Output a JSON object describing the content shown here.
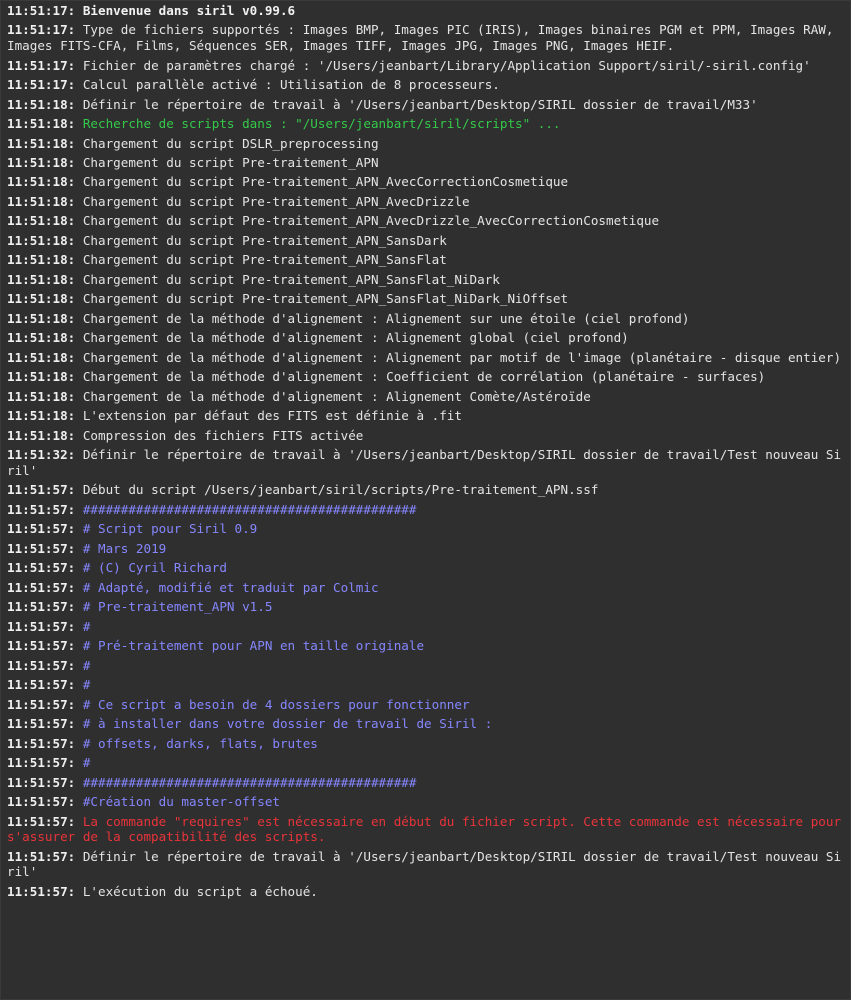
{
  "colors": {
    "background": "#2f2f2f",
    "text": "#e4e4e4",
    "green": "#35c94a",
    "blue": "#8686ff",
    "red": "#e8343a"
  },
  "log": [
    {
      "time": "11:51:17:",
      "text": "Bienvenue dans siril v0.99.6",
      "style": "bold"
    },
    {
      "time": "11:51:17:",
      "text": "Type de fichiers supportés : Images BMP, Images PIC (IRIS), Images binaires PGM et PPM, Images RAW, Images FITS-CFA, Films, Séquences SER, Images TIFF, Images JPG, Images PNG, Images HEIF.",
      "style": "normal"
    },
    {
      "time": "11:51:17:",
      "text": "Fichier de paramètres chargé : '/Users/jeanbart/Library/Application Support/siril/-siril.config'",
      "style": "normal"
    },
    {
      "time": "11:51:17:",
      "text": "Calcul parallèle activé : Utilisation de 8 processeurs.",
      "style": "normal"
    },
    {
      "time": "11:51:18:",
      "text": "Définir le répertoire de travail à '/Users/jeanbart/Desktop/SIRIL dossier de travail/M33'",
      "style": "normal"
    },
    {
      "time": "11:51:18:",
      "text": "Recherche de scripts dans : \"/Users/jeanbart/siril/scripts\" ...",
      "style": "green"
    },
    {
      "time": "11:51:18:",
      "text": "Chargement du script DSLR_preprocessing",
      "style": "normal"
    },
    {
      "time": "11:51:18:",
      "text": "Chargement du script Pre-traitement_APN",
      "style": "normal"
    },
    {
      "time": "11:51:18:",
      "text": "Chargement du script Pre-traitement_APN_AvecCorrectionCosmetique",
      "style": "normal"
    },
    {
      "time": "11:51:18:",
      "text": "Chargement du script Pre-traitement_APN_AvecDrizzle",
      "style": "normal"
    },
    {
      "time": "11:51:18:",
      "text": "Chargement du script Pre-traitement_APN_AvecDrizzle_AvecCorrectionCosmetique",
      "style": "normal"
    },
    {
      "time": "11:51:18:",
      "text": "Chargement du script Pre-traitement_APN_SansDark",
      "style": "normal"
    },
    {
      "time": "11:51:18:",
      "text": "Chargement du script Pre-traitement_APN_SansFlat",
      "style": "normal"
    },
    {
      "time": "11:51:18:",
      "text": "Chargement du script Pre-traitement_APN_SansFlat_NiDark",
      "style": "normal"
    },
    {
      "time": "11:51:18:",
      "text": "Chargement du script Pre-traitement_APN_SansFlat_NiDark_NiOffset",
      "style": "normal"
    },
    {
      "time": "11:51:18:",
      "text": "Chargement de la méthode d'alignement : Alignement sur une étoile (ciel profond)",
      "style": "normal"
    },
    {
      "time": "11:51:18:",
      "text": "Chargement de la méthode d'alignement : Alignement global (ciel profond)",
      "style": "normal"
    },
    {
      "time": "11:51:18:",
      "text": "Chargement de la méthode d'alignement : Alignement par motif de l'image (planétaire - disque entier)",
      "style": "normal"
    },
    {
      "time": "11:51:18:",
      "text": "Chargement de la méthode d'alignement : Coefficient de corrélation (planétaire - surfaces)",
      "style": "normal"
    },
    {
      "time": "11:51:18:",
      "text": "Chargement de la méthode d'alignement : Alignement Comète/Astéroïde",
      "style": "normal"
    },
    {
      "time": "11:51:18:",
      "text": "L'extension par défaut des FITS est définie à .fit",
      "style": "normal"
    },
    {
      "time": "11:51:18:",
      "text": "Compression des fichiers FITS activée",
      "style": "normal"
    },
    {
      "time": "11:51:32:",
      "text": "Définir le répertoire de travail à '/Users/jeanbart/Desktop/SIRIL dossier de travail/Test nouveau Siril'",
      "style": "normal"
    },
    {
      "time": "11:51:57:",
      "text": "Début du script /Users/jeanbart/siril/scripts/Pre-traitement_APN.ssf",
      "style": "normal"
    },
    {
      "time": "11:51:57:",
      "text": "############################################",
      "style": "blue"
    },
    {
      "time": "11:51:57:",
      "text": "# Script pour Siril 0.9",
      "style": "blue"
    },
    {
      "time": "11:51:57:",
      "text": "# Mars 2019",
      "style": "blue"
    },
    {
      "time": "11:51:57:",
      "text": "# (C) Cyril Richard",
      "style": "blue"
    },
    {
      "time": "11:51:57:",
      "text": "# Adapté, modifié et traduit par Colmic",
      "style": "blue"
    },
    {
      "time": "11:51:57:",
      "text": "# Pre-traitement_APN v1.5",
      "style": "blue"
    },
    {
      "time": "11:51:57:",
      "text": "#",
      "style": "blue"
    },
    {
      "time": "11:51:57:",
      "text": "# Pré-traitement pour APN en taille originale",
      "style": "blue"
    },
    {
      "time": "11:51:57:",
      "text": "#",
      "style": "blue"
    },
    {
      "time": "11:51:57:",
      "text": "#",
      "style": "blue"
    },
    {
      "time": "11:51:57:",
      "text": "# Ce script a besoin de 4 dossiers pour fonctionner",
      "style": "blue"
    },
    {
      "time": "11:51:57:",
      "text": "# à installer dans votre dossier de travail de Siril :",
      "style": "blue"
    },
    {
      "time": "11:51:57:",
      "text": "# offsets, darks, flats, brutes",
      "style": "blue"
    },
    {
      "time": "11:51:57:",
      "text": "#",
      "style": "blue"
    },
    {
      "time": "11:51:57:",
      "text": "############################################",
      "style": "blue"
    },
    {
      "time": "11:51:57:",
      "text": "#Création du master-offset",
      "style": "blue"
    },
    {
      "time": "11:51:57:",
      "text": "La commande \"requires\" est nécessaire en début du fichier script. Cette commande est nécessaire pour s'assurer de la compatibilité des scripts.",
      "style": "red"
    },
    {
      "time": "11:51:57:",
      "text": "Définir le répertoire de travail à '/Users/jeanbart/Desktop/SIRIL dossier de travail/Test nouveau Siril'",
      "style": "normal"
    },
    {
      "time": "11:51:57:",
      "text": "L'exécution du script a échoué.",
      "style": "normal"
    }
  ]
}
